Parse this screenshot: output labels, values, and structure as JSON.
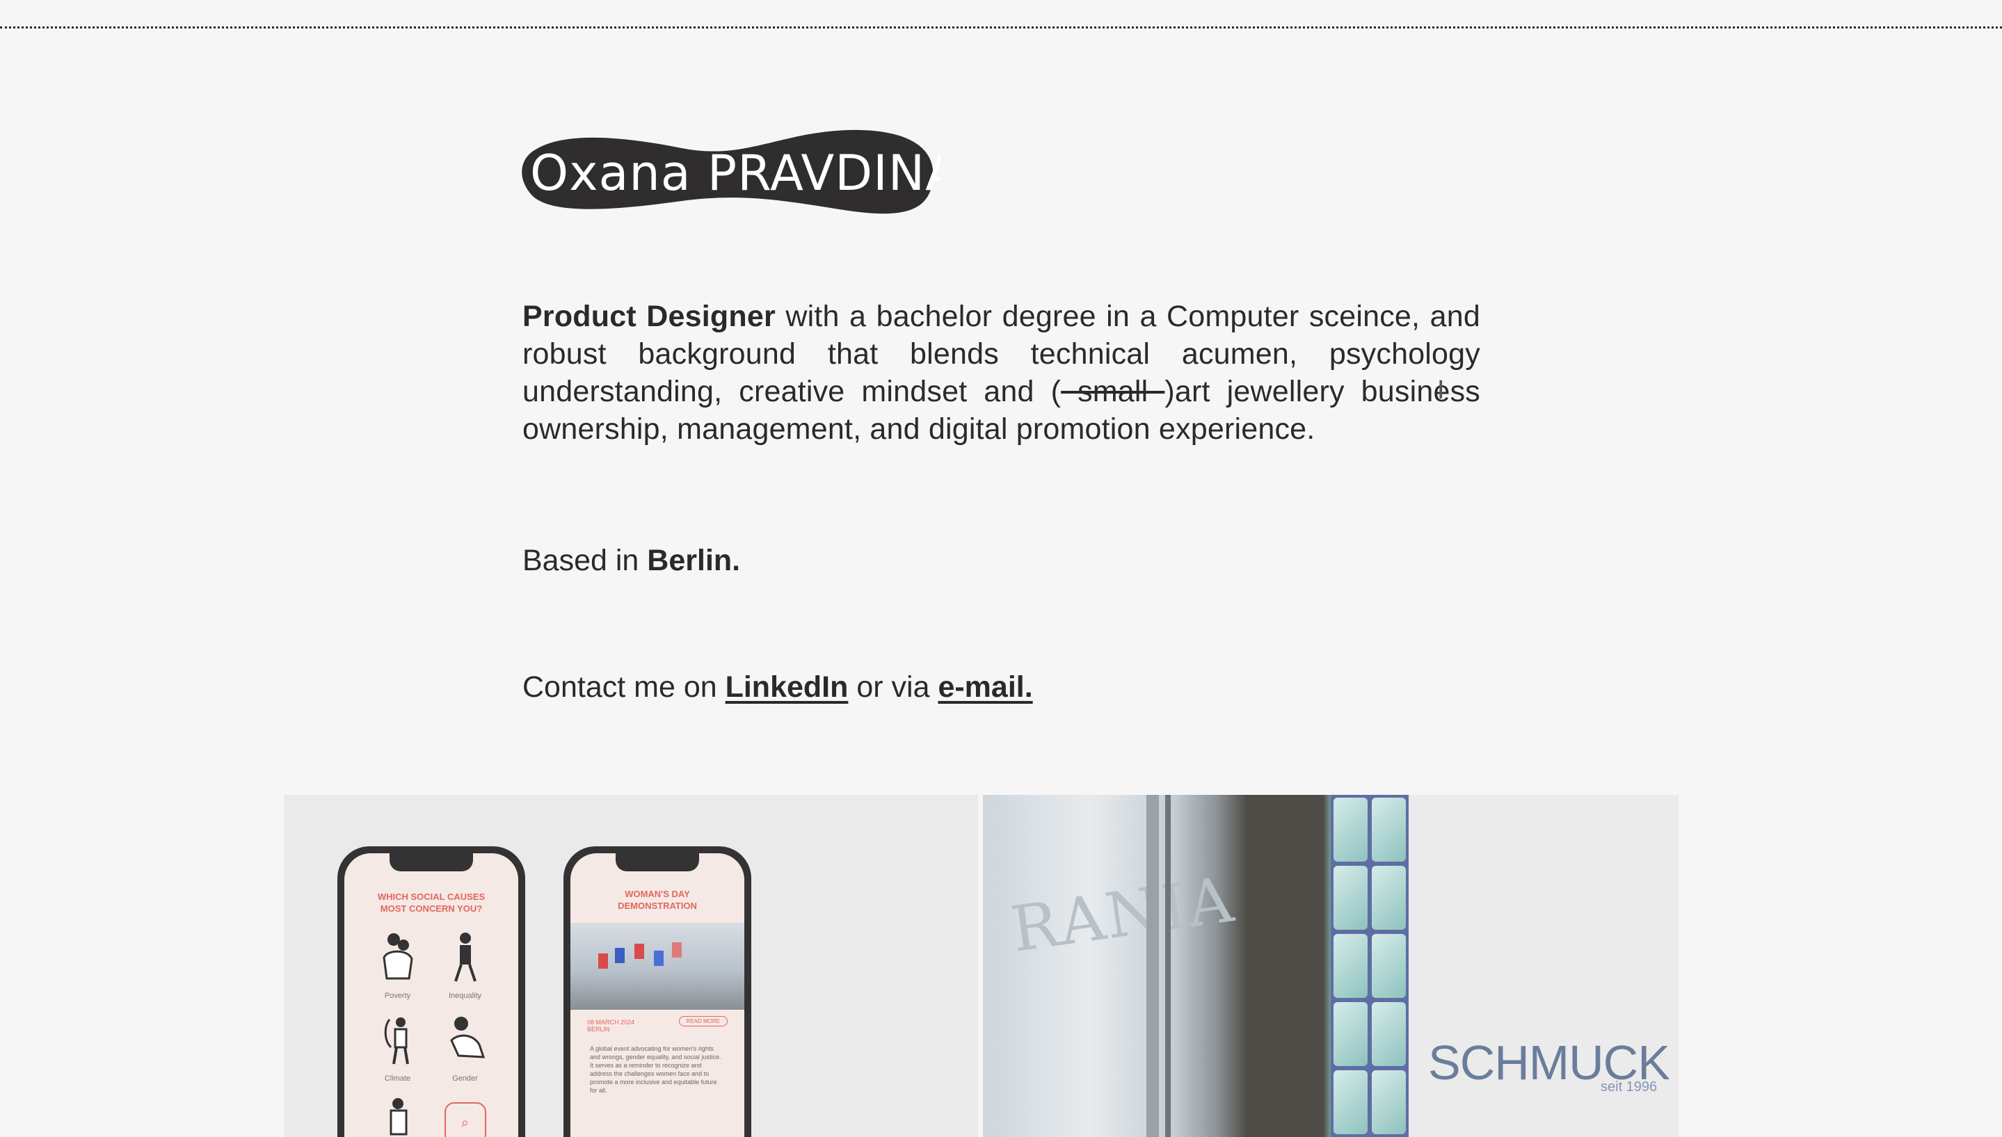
{
  "logo": {
    "text": "Oxana PRAVDINA"
  },
  "bio": {
    "role": "Product Designer",
    "text_1": " with a bachelor degree in a Computer sceince, and robust background that blends technical acumen, psychology understanding, creative mindset and (",
    "struck": " small ",
    "text_2": ")art jewellery business ownership, management, and digital promotion experience."
  },
  "location": {
    "prefix": "Based in ",
    "city": "Berlin."
  },
  "contact": {
    "prefix": "Contact me on ",
    "linkedin_label": "LinkedIn",
    "middle": " or via ",
    "email_label": "e-mail."
  },
  "projects": {
    "app": {
      "phone1_title": "WHICH SOCIAL CAUSES MOST CONCERN YOU?",
      "causes": [
        "Poverty",
        "Inequality",
        "Climate",
        "Gender"
      ],
      "phone2_title": "WOMAN'S DAY DEMONSTRATION",
      "date": "08 MARCH 2024",
      "place": "BERLIN",
      "read_more": "READ MORE",
      "description": "A global event advocating for women's rights and wrongs, gender equality, and social justice. It serves as a reminder to recognize and address the challenges women face and to promote a more inclusive and equitable future for all."
    },
    "schmuck": {
      "engraving": "RANIA",
      "brand": "SCHMUCK",
      "since": "seit 1996"
    }
  },
  "colors": {
    "accent": "#e2675a",
    "text": "#2b2a2a",
    "brand": "#6a7d9c",
    "background": "#f7f6f6"
  }
}
